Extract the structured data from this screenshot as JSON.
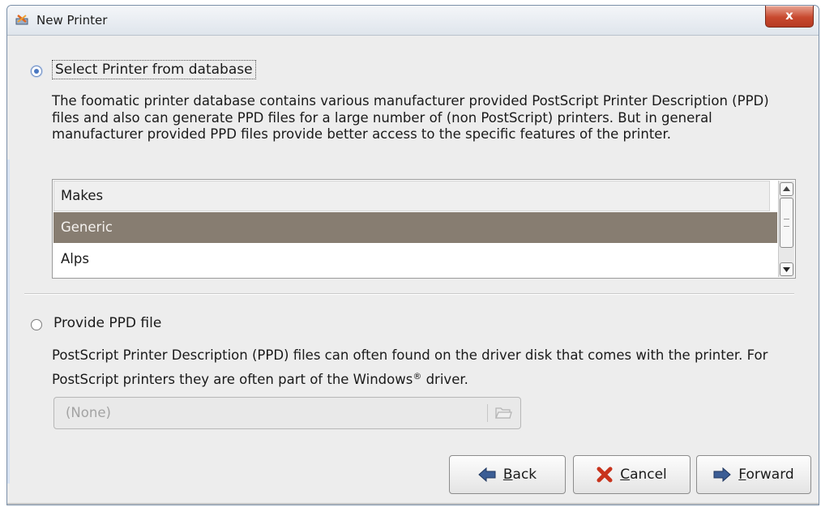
{
  "window": {
    "title": "New Printer",
    "close_label": "x"
  },
  "option_database": {
    "label": "Select Printer from database",
    "selected": true,
    "description": "The foomatic printer database contains various manufacturer provided PostScript Printer Description (PPD) files and also can generate PPD files for a large number of (non PostScript) printers. But in general manufacturer provided PPD files provide better access to the specific features of the printer.",
    "list": {
      "header": "Makes",
      "rows": [
        "Generic",
        "Alps"
      ],
      "selected_row": "Generic"
    }
  },
  "option_ppd": {
    "label": "Provide PPD file",
    "selected": false,
    "description_part1": "PostScript Printer Description (PPD) files can often found on the driver disk that comes with the printer. For PostScript printers they are often part of the Windows",
    "description_reg": "®",
    "description_part2": " driver.",
    "file_value": "(None)"
  },
  "buttons": {
    "back_mnemonic": "B",
    "back_rest": "ack",
    "cancel_mnemonic": "C",
    "cancel_rest": "ancel",
    "forward_mnemonic": "F",
    "forward_rest": "orward"
  },
  "colors": {
    "selected_row": "#877d71",
    "close_button": "#c8492f",
    "radio_dot": "#4a78c2"
  }
}
